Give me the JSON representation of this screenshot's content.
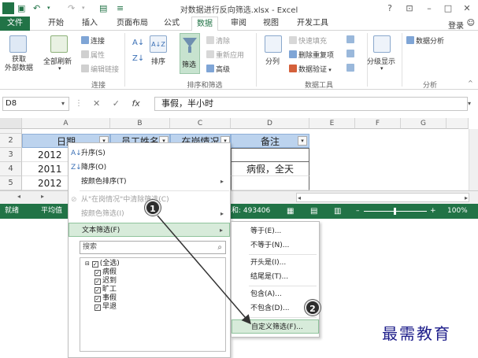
{
  "window": {
    "title": "对数据进行反向筛选.xlsx - Excel",
    "help": "?",
    "login": "登录"
  },
  "tabs": [
    "文件",
    "开始",
    "插入",
    "页面布局",
    "公式",
    "数据",
    "审阅",
    "视图",
    "开发工具"
  ],
  "ribbon": {
    "get_external": "获取\n外部数据",
    "refresh_all": "全部刷新",
    "connections": "连接",
    "properties": "属性",
    "edit_links": "编辑链接",
    "group_connections": "连接",
    "sort_az": "A↓Z",
    "sort": "排序",
    "filter": "筛选",
    "clear": "清除",
    "reapply": "重新应用",
    "advanced": "高级",
    "group_sortfilter": "排序和筛选",
    "split": "分列",
    "flash_fill": "快速填充",
    "remove_dup": "删除重复项",
    "validation": "数据验证",
    "group_tools": "数据工具",
    "outline": "分级显示",
    "analysis": "数据分析",
    "group_analysis": "分析"
  },
  "formula_bar": {
    "name_box": "D8",
    "fx": "fx",
    "value": "事假，半小时"
  },
  "grid": {
    "columns": [
      "A",
      "B",
      "C",
      "D",
      "E",
      "F",
      "G"
    ],
    "rows": [
      "1",
      "2",
      "3",
      "4",
      "5"
    ],
    "header_row": [
      "日期",
      "员工姓名",
      "在岗情况",
      "备注"
    ],
    "cells": {
      "a3": "2012",
      "a4": "2011",
      "a5": "2012",
      "d4": "病假，全天"
    }
  },
  "status": {
    "ready": "就绪",
    "avg": "平均值",
    "sum": "和: 493406",
    "zoom": "100%"
  },
  "menu": {
    "sort_asc": "升序(S)",
    "sort_desc": "降序(O)",
    "sort_color": "按颜色排序(T)",
    "clear_filter": "从\"在岗情况\"中清除筛选(C)",
    "filter_color": "按颜色筛选(I)",
    "text_filter": "文本筛选(F)",
    "search_placeholder": "搜索",
    "checks": [
      "(全选)",
      "病假",
      "迟到",
      "旷工",
      "事假",
      "早退"
    ]
  },
  "submenu": {
    "items": [
      "等于(E)...",
      "不等于(N)...",
      "开头是(I)...",
      "结尾是(T)...",
      "包含(A)...",
      "不包含(D)...",
      "自定义筛选(F)..."
    ]
  },
  "callouts": [
    "1",
    "2"
  ],
  "watermark": "最需教育",
  "colors": {
    "excel_green": "#217346",
    "header_blue": "#bcd3ee",
    "highlight": "#d7ebda"
  }
}
